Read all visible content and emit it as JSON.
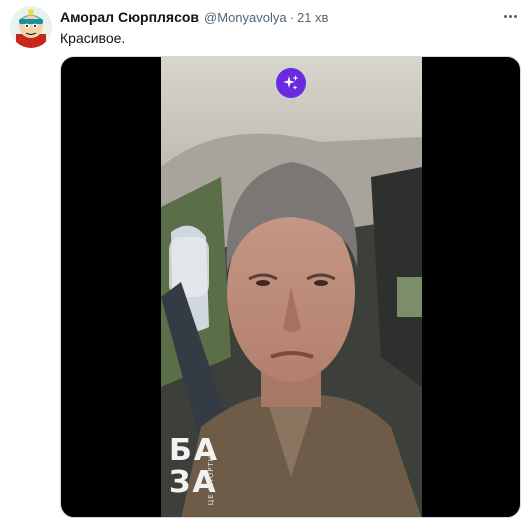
{
  "tweet": {
    "author_name": "Аморал Сюрплясов",
    "handle": "@Monyavolya",
    "separator": "·",
    "time": "21 хв",
    "text": "Красивое."
  },
  "media": {
    "watermark_line1": "БА",
    "watermark_line2": "ЗА",
    "watermark_sub": "ЦЕ KHOPTH"
  },
  "colors": {
    "name": "#0f1419",
    "secondary": "#536471",
    "sparkle_badge": "#6a2be0"
  },
  "icons": [
    "avatar",
    "more-options-icon",
    "sparkle-icon"
  ]
}
